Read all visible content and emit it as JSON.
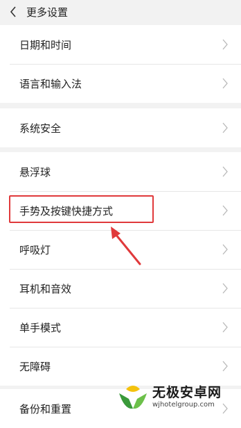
{
  "header": {
    "title": "更多设置",
    "back_icon": "chevron-left-icon"
  },
  "groups": [
    {
      "items": [
        "日期和时间",
        "语言和输入法"
      ]
    },
    {
      "items": [
        "系统安全"
      ]
    },
    {
      "items": [
        "悬浮球",
        "手势及按键快捷方式",
        "呼吸灯",
        "耳机和音效",
        "单手模式",
        "无障碍"
      ]
    },
    {
      "items": [
        "备份和重置"
      ]
    }
  ],
  "annotation": {
    "highlight_color": "#e0393b",
    "highlighted_item": "手势及按键快捷方式"
  },
  "watermark": {
    "name": "无极安卓网",
    "url": "wjhotelgroup.com"
  }
}
